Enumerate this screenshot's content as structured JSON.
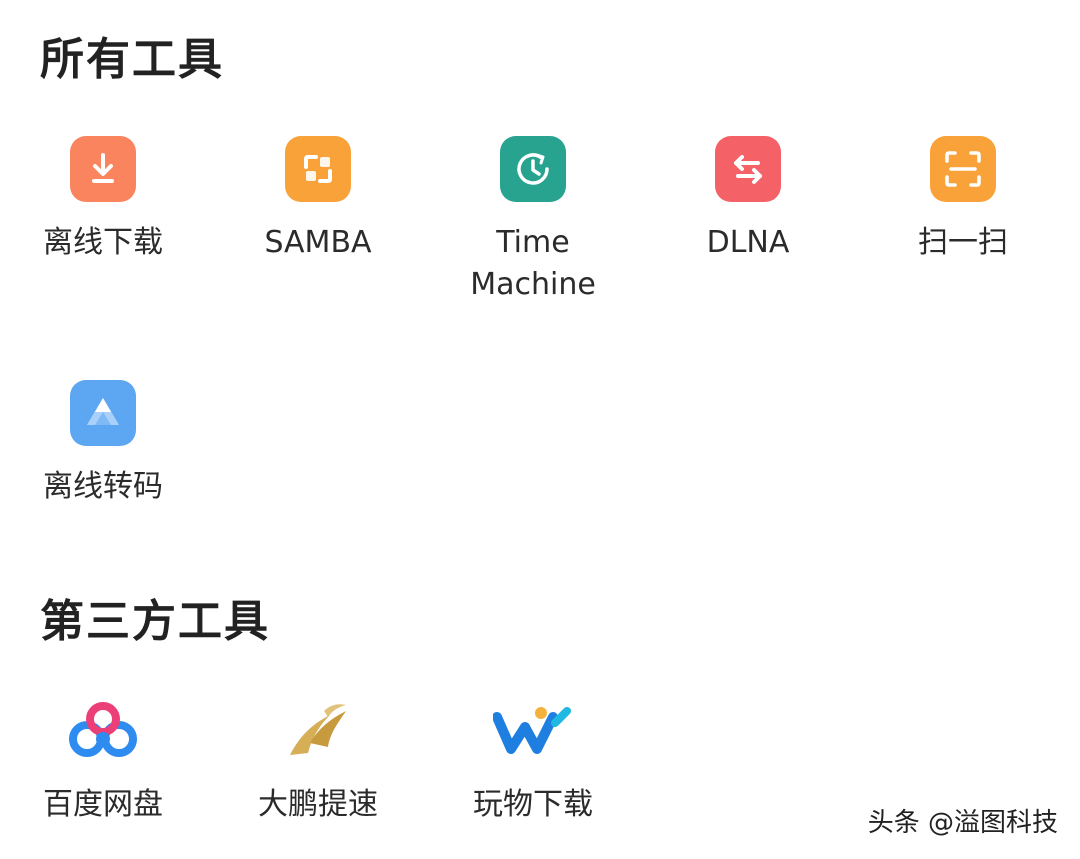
{
  "sections": {
    "all_tools": {
      "title": "所有工具",
      "items": [
        {
          "label": "离线下载",
          "icon": "download-icon",
          "color": "#F9845E"
        },
        {
          "label": "SAMBA",
          "icon": "samba-icon",
          "color": "#F9A23A"
        },
        {
          "label": "Time\nMachine",
          "icon": "clock-icon",
          "color": "#27A390"
        },
        {
          "label": "DLNA",
          "icon": "swap-arrows-icon",
          "color": "#F46268"
        },
        {
          "label": "扫一扫",
          "icon": "scan-icon",
          "color": "#F9A23A"
        },
        {
          "label": "离线转码",
          "icon": "transcode-triangle-icon",
          "color": "#5CA6F2"
        }
      ]
    },
    "third_party_tools": {
      "title": "第三方工具",
      "items": [
        {
          "label": "百度网盘",
          "icon": "baidu-netdisk-logo-icon"
        },
        {
          "label": "大鹏提速",
          "icon": "dapeng-logo-icon"
        },
        {
          "label": "玩物下载",
          "icon": "wanwu-logo-icon"
        }
      ]
    }
  },
  "watermark": "头条 @溢图科技"
}
